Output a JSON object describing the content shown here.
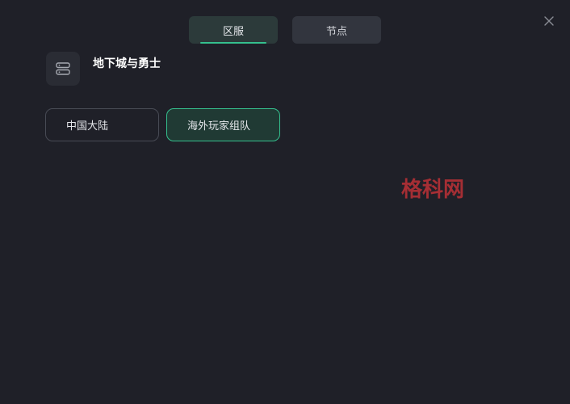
{
  "tabs": [
    {
      "label": "区服",
      "active": true
    },
    {
      "label": "节点",
      "active": false
    }
  ],
  "game": {
    "title": "地下城与勇士",
    "icon": "server-stack-icon"
  },
  "regions": [
    {
      "label": "中国大陆",
      "selected": false
    },
    {
      "label": "海外玩家组队",
      "selected": true
    }
  ],
  "watermark": "格科网",
  "colors": {
    "background": "#1f2028",
    "accent": "#35c08e",
    "watermark": "#a52e34"
  }
}
